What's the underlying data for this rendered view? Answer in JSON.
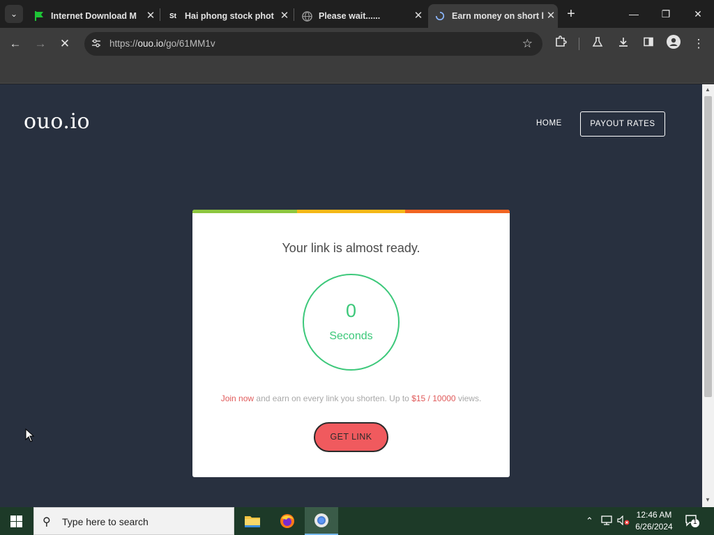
{
  "browser": {
    "tabs": [
      {
        "title": "Internet Download M",
        "favicon": "green-flag-icon"
      },
      {
        "title": "Hai phong stock phot",
        "favicon": "st-icon"
      },
      {
        "title": "Please wait......",
        "favicon": "globe-icon"
      },
      {
        "title": "Earn money on short l",
        "favicon": "loading-icon",
        "active": true
      }
    ],
    "url_prefix": "https://",
    "url_host": "ouo.io",
    "url_path": "/go/61MM1v"
  },
  "site": {
    "logo": "ouo.io",
    "nav_home": "HOME",
    "nav_payout": "PAYOUT RATES"
  },
  "card": {
    "title": "Your link is almost ready.",
    "timer_value": "0",
    "timer_label": "Seconds",
    "promo_join": "Join now",
    "promo_middle": " and earn on every link you shorten. Up to ",
    "promo_rate": "$15 / 10000",
    "promo_end": " views.",
    "button": "GET LINK",
    "bar_colors": [
      "#8dc63f",
      "#f5b818",
      "#f26522"
    ]
  },
  "taskbar": {
    "search_placeholder": "Type here to search",
    "time": "12:46 AM",
    "date": "6/26/2024",
    "notifications": "1"
  }
}
